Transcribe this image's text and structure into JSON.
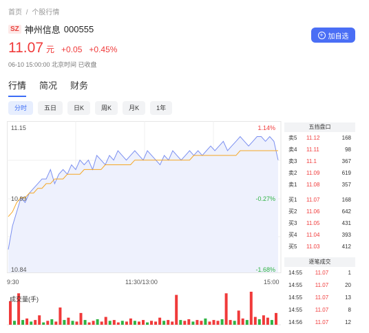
{
  "breadcrumb": {
    "home": "首页",
    "sep": "/",
    "current": "个股行情"
  },
  "stock": {
    "market": "SZ",
    "name": "神州信息",
    "code": "000555",
    "price": "11.07",
    "unit": "元",
    "change": "+0.05",
    "change_pct": "+0.45%",
    "time_status": "06-10 15:00:00 北京时间 已收盘"
  },
  "add_button": {
    "label": "加自选"
  },
  "tabs": [
    {
      "label": "行情",
      "active": true
    },
    {
      "label": "简况",
      "active": false
    },
    {
      "label": "财务",
      "active": false
    }
  ],
  "periods": [
    {
      "label": "分时",
      "active": true
    },
    {
      "label": "五日",
      "active": false
    },
    {
      "label": "日K",
      "active": false
    },
    {
      "label": "周K",
      "active": false
    },
    {
      "label": "月K",
      "active": false
    },
    {
      "label": "1年",
      "active": false
    }
  ],
  "chart": {
    "price_top": "11.15",
    "price_mid": "10.99",
    "price_bottom": "10.84",
    "pct_top": "1.14%",
    "pct_mid": "-0.27%",
    "pct_bottom": "-1.68%",
    "time_start": "9:30",
    "time_mid": "11:30/13:00",
    "time_end": "15:00",
    "volume_label": "成交量(手)",
    "colors": {
      "up": "#f03a3a",
      "down": "#2fb344",
      "price_line": "#7b8ff0",
      "avg_line": "#f5a623"
    }
  },
  "chart_data": {
    "type": "line",
    "ylim": [
      10.84,
      11.15
    ],
    "series": [
      {
        "values": [
          10.88,
          10.93,
          10.96,
          10.99,
          10.98,
          11.0,
          11.01,
          11.02,
          11.03,
          11.03,
          11.05,
          11.02,
          11.04,
          11.05,
          11.04,
          11.06,
          11.05,
          11.07,
          11.06,
          11.07,
          11.05,
          11.08,
          11.07,
          11.06,
          11.08,
          11.07,
          11.09,
          11.08,
          11.07,
          11.08,
          11.09,
          11.08,
          11.07,
          11.09,
          11.08,
          11.07,
          11.06,
          11.08,
          11.07,
          11.09,
          11.08,
          11.07,
          11.08,
          11.09,
          11.08,
          11.09,
          11.08,
          11.09,
          11.1,
          11.09,
          11.1,
          11.11,
          11.09,
          11.1,
          11.11,
          11.12,
          11.11,
          11.1,
          11.11,
          11.12,
          11.12,
          11.11,
          11.12,
          11.11,
          11.07
        ]
      },
      {
        "values": [
          10.95,
          10.96,
          10.98,
          10.99,
          10.99,
          11.0,
          11.0,
          11.01,
          11.01,
          11.02,
          11.02,
          11.03,
          11.03,
          11.03,
          11.04,
          11.04,
          11.04,
          11.04,
          11.05,
          11.05,
          11.05,
          11.05,
          11.05,
          11.06,
          11.06,
          11.06,
          11.06,
          11.06,
          11.06,
          11.06,
          11.07,
          11.07,
          11.07,
          11.07,
          11.07,
          11.07,
          11.07,
          11.07,
          11.07,
          11.07,
          11.07,
          11.07,
          11.07,
          11.07,
          11.08,
          11.08,
          11.08,
          11.08,
          11.08,
          11.08,
          11.08,
          11.08,
          11.08,
          11.08,
          11.08,
          11.09,
          11.09,
          11.09,
          11.09,
          11.09,
          11.09,
          11.09,
          11.09,
          11.09,
          11.09
        ]
      }
    ],
    "volumes": [
      {
        "v": 30,
        "d": "up"
      },
      {
        "v": 5,
        "d": "down"
      },
      {
        "v": 40,
        "d": "up"
      },
      {
        "v": 6,
        "d": "down"
      },
      {
        "v": 8,
        "d": "up"
      },
      {
        "v": 4,
        "d": "down"
      },
      {
        "v": 6,
        "d": "up"
      },
      {
        "v": 12,
        "d": "up"
      },
      {
        "v": 3,
        "d": "down"
      },
      {
        "v": 5,
        "d": "up"
      },
      {
        "v": 7,
        "d": "down"
      },
      {
        "v": 4,
        "d": "up"
      },
      {
        "v": 22,
        "d": "up"
      },
      {
        "v": 6,
        "d": "down"
      },
      {
        "v": 9,
        "d": "up"
      },
      {
        "v": 5,
        "d": "down"
      },
      {
        "v": 4,
        "d": "up"
      },
      {
        "v": 15,
        "d": "up"
      },
      {
        "v": 6,
        "d": "down"
      },
      {
        "v": 3,
        "d": "up"
      },
      {
        "v": 5,
        "d": "up"
      },
      {
        "v": 7,
        "d": "down"
      },
      {
        "v": 4,
        "d": "up"
      },
      {
        "v": 10,
        "d": "up"
      },
      {
        "v": 5,
        "d": "down"
      },
      {
        "v": 6,
        "d": "up"
      },
      {
        "v": 3,
        "d": "up"
      },
      {
        "v": 5,
        "d": "down"
      },
      {
        "v": 4,
        "d": "up"
      },
      {
        "v": 8,
        "d": "up"
      },
      {
        "v": 5,
        "d": "down"
      },
      {
        "v": 4,
        "d": "up"
      },
      {
        "v": 6,
        "d": "up"
      },
      {
        "v": 3,
        "d": "down"
      },
      {
        "v": 5,
        "d": "up"
      },
      {
        "v": 4,
        "d": "up"
      },
      {
        "v": 9,
        "d": "up"
      },
      {
        "v": 5,
        "d": "down"
      },
      {
        "v": 6,
        "d": "up"
      },
      {
        "v": 4,
        "d": "up"
      },
      {
        "v": 38,
        "d": "up"
      },
      {
        "v": 6,
        "d": "down"
      },
      {
        "v": 5,
        "d": "up"
      },
      {
        "v": 7,
        "d": "up"
      },
      {
        "v": 4,
        "d": "down"
      },
      {
        "v": 6,
        "d": "up"
      },
      {
        "v": 5,
        "d": "up"
      },
      {
        "v": 8,
        "d": "down"
      },
      {
        "v": 4,
        "d": "up"
      },
      {
        "v": 6,
        "d": "up"
      },
      {
        "v": 5,
        "d": "up"
      },
      {
        "v": 7,
        "d": "down"
      },
      {
        "v": 40,
        "d": "up"
      },
      {
        "v": 6,
        "d": "up"
      },
      {
        "v": 5,
        "d": "down"
      },
      {
        "v": 18,
        "d": "up"
      },
      {
        "v": 8,
        "d": "up"
      },
      {
        "v": 6,
        "d": "down"
      },
      {
        "v": 42,
        "d": "up"
      },
      {
        "v": 10,
        "d": "up"
      },
      {
        "v": 7,
        "d": "down"
      },
      {
        "v": 12,
        "d": "up"
      },
      {
        "v": 9,
        "d": "up"
      },
      {
        "v": 6,
        "d": "down"
      },
      {
        "v": 15,
        "d": "up"
      }
    ]
  },
  "order_book": {
    "header": "五挡盘口",
    "asks": [
      {
        "label": "卖5",
        "price": "11.12",
        "vol": "168"
      },
      {
        "label": "卖4",
        "price": "11.11",
        "vol": "98"
      },
      {
        "label": "卖3",
        "price": "11.1",
        "vol": "367"
      },
      {
        "label": "卖2",
        "price": "11.09",
        "vol": "619"
      },
      {
        "label": "卖1",
        "price": "11.08",
        "vol": "357"
      }
    ],
    "bids": [
      {
        "label": "买1",
        "price": "11.07",
        "vol": "168"
      },
      {
        "label": "买2",
        "price": "11.06",
        "vol": "642"
      },
      {
        "label": "买3",
        "price": "11.05",
        "vol": "431"
      },
      {
        "label": "买4",
        "price": "11.04",
        "vol": "393"
      },
      {
        "label": "买5",
        "price": "11.03",
        "vol": "412"
      }
    ]
  },
  "trades": {
    "header": "逐笔成交",
    "rows": [
      {
        "time": "14:55",
        "price": "11.07",
        "vol": "1"
      },
      {
        "time": "14:55",
        "price": "11.07",
        "vol": "20"
      },
      {
        "time": "14:55",
        "price": "11.07",
        "vol": "13"
      },
      {
        "time": "14:55",
        "price": "11.07",
        "vol": "8"
      },
      {
        "time": "14:56",
        "price": "11.07",
        "vol": "12"
      }
    ]
  }
}
